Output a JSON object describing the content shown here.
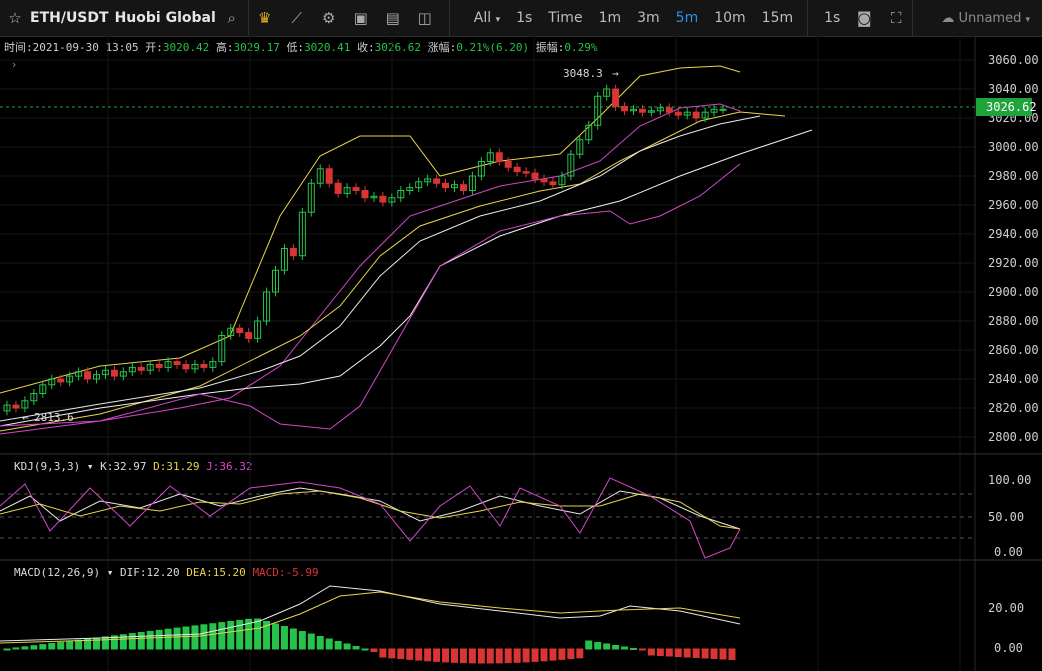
{
  "toolbar": {
    "symbol": "ETH/USDT",
    "exchange": "Huobi Global",
    "all_label": "All",
    "timeframes": [
      "1s",
      "Time",
      "1m",
      "3m",
      "5m",
      "10m",
      "15m"
    ],
    "active_timeframe": "5m",
    "extra_tf": "1s",
    "user": "Unnamed"
  },
  "info": {
    "time_label": "时间:",
    "time": "2021-09-30 13:05",
    "open_label": "开:",
    "open": "3020.42",
    "high_label": "高:",
    "high": "3029.17",
    "low_label": "低:",
    "low": "3020.41",
    "close_label": "收:",
    "close": "3026.62",
    "change_label": "涨幅:",
    "change": "0.21%(6.20)",
    "amp_label": "振幅:",
    "amp": "0.29%"
  },
  "price_axis": {
    "ticks": [
      "3060.00",
      "3040.00",
      "3020.00",
      "3000.00",
      "2980.00",
      "2960.00",
      "2940.00",
      "2920.00",
      "2900.00",
      "2880.00",
      "2860.00",
      "2840.00",
      "2820.00",
      "2800.00"
    ],
    "last_price": "3026.62",
    "max_marker": "3048.3",
    "min_marker": "2813.6"
  },
  "kdj": {
    "name": "KDJ(9,3,3)",
    "k_label": "K:32.97",
    "d_label": "D:31.29",
    "j_label": "J:36.32",
    "ticks": [
      "100.00",
      "50.00",
      "0.00"
    ]
  },
  "macd": {
    "name": "MACD(12,26,9)",
    "dif_label": "DIF:12.20",
    "dea_label": "DEA:15.20",
    "macd_label": "MACD:-5.99",
    "ticks": [
      "20.00",
      "0.00"
    ]
  },
  "colors": {
    "up": "#26c24a",
    "down": "#d83535",
    "accent": "#2e8dea",
    "last_price_bg": "#1fa43a"
  }
}
